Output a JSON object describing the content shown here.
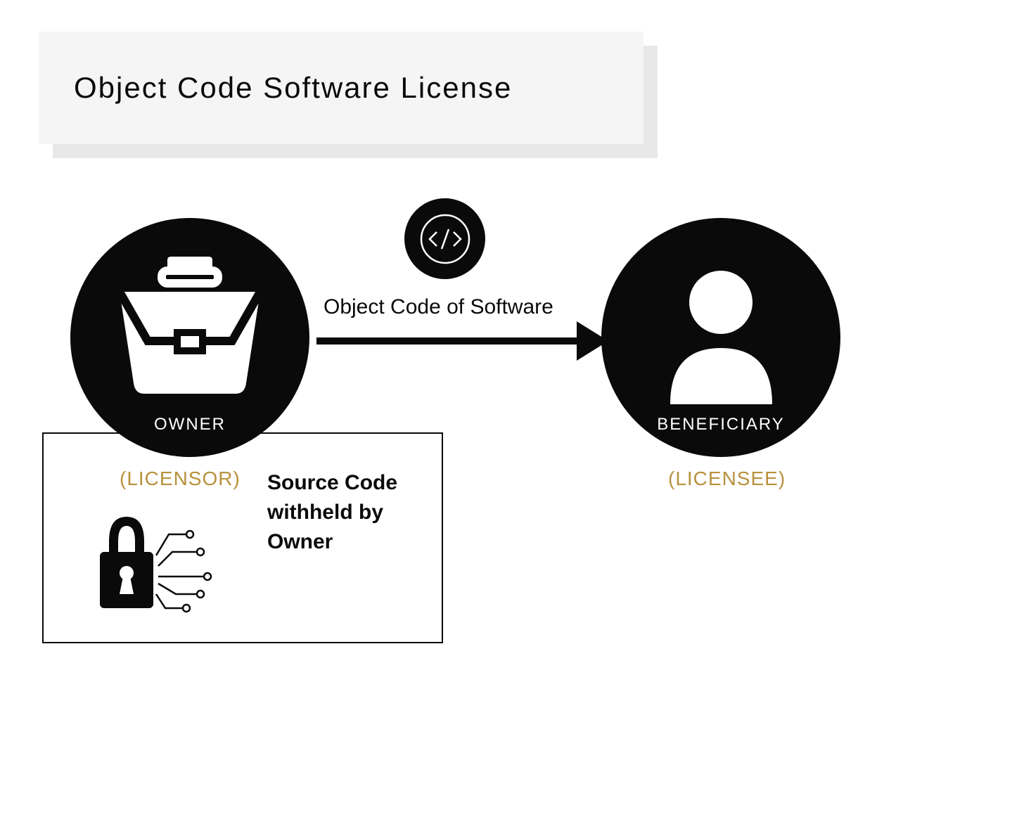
{
  "title": "Object Code Software License",
  "owner": {
    "label": "OWNER",
    "role": "(LICENSOR)"
  },
  "beneficiary": {
    "label": "BENEFICIARY",
    "role": "(LICENSEE)"
  },
  "transfer_label": "Object Code of Software",
  "source_code_note": "Source Code withheld by Owner"
}
